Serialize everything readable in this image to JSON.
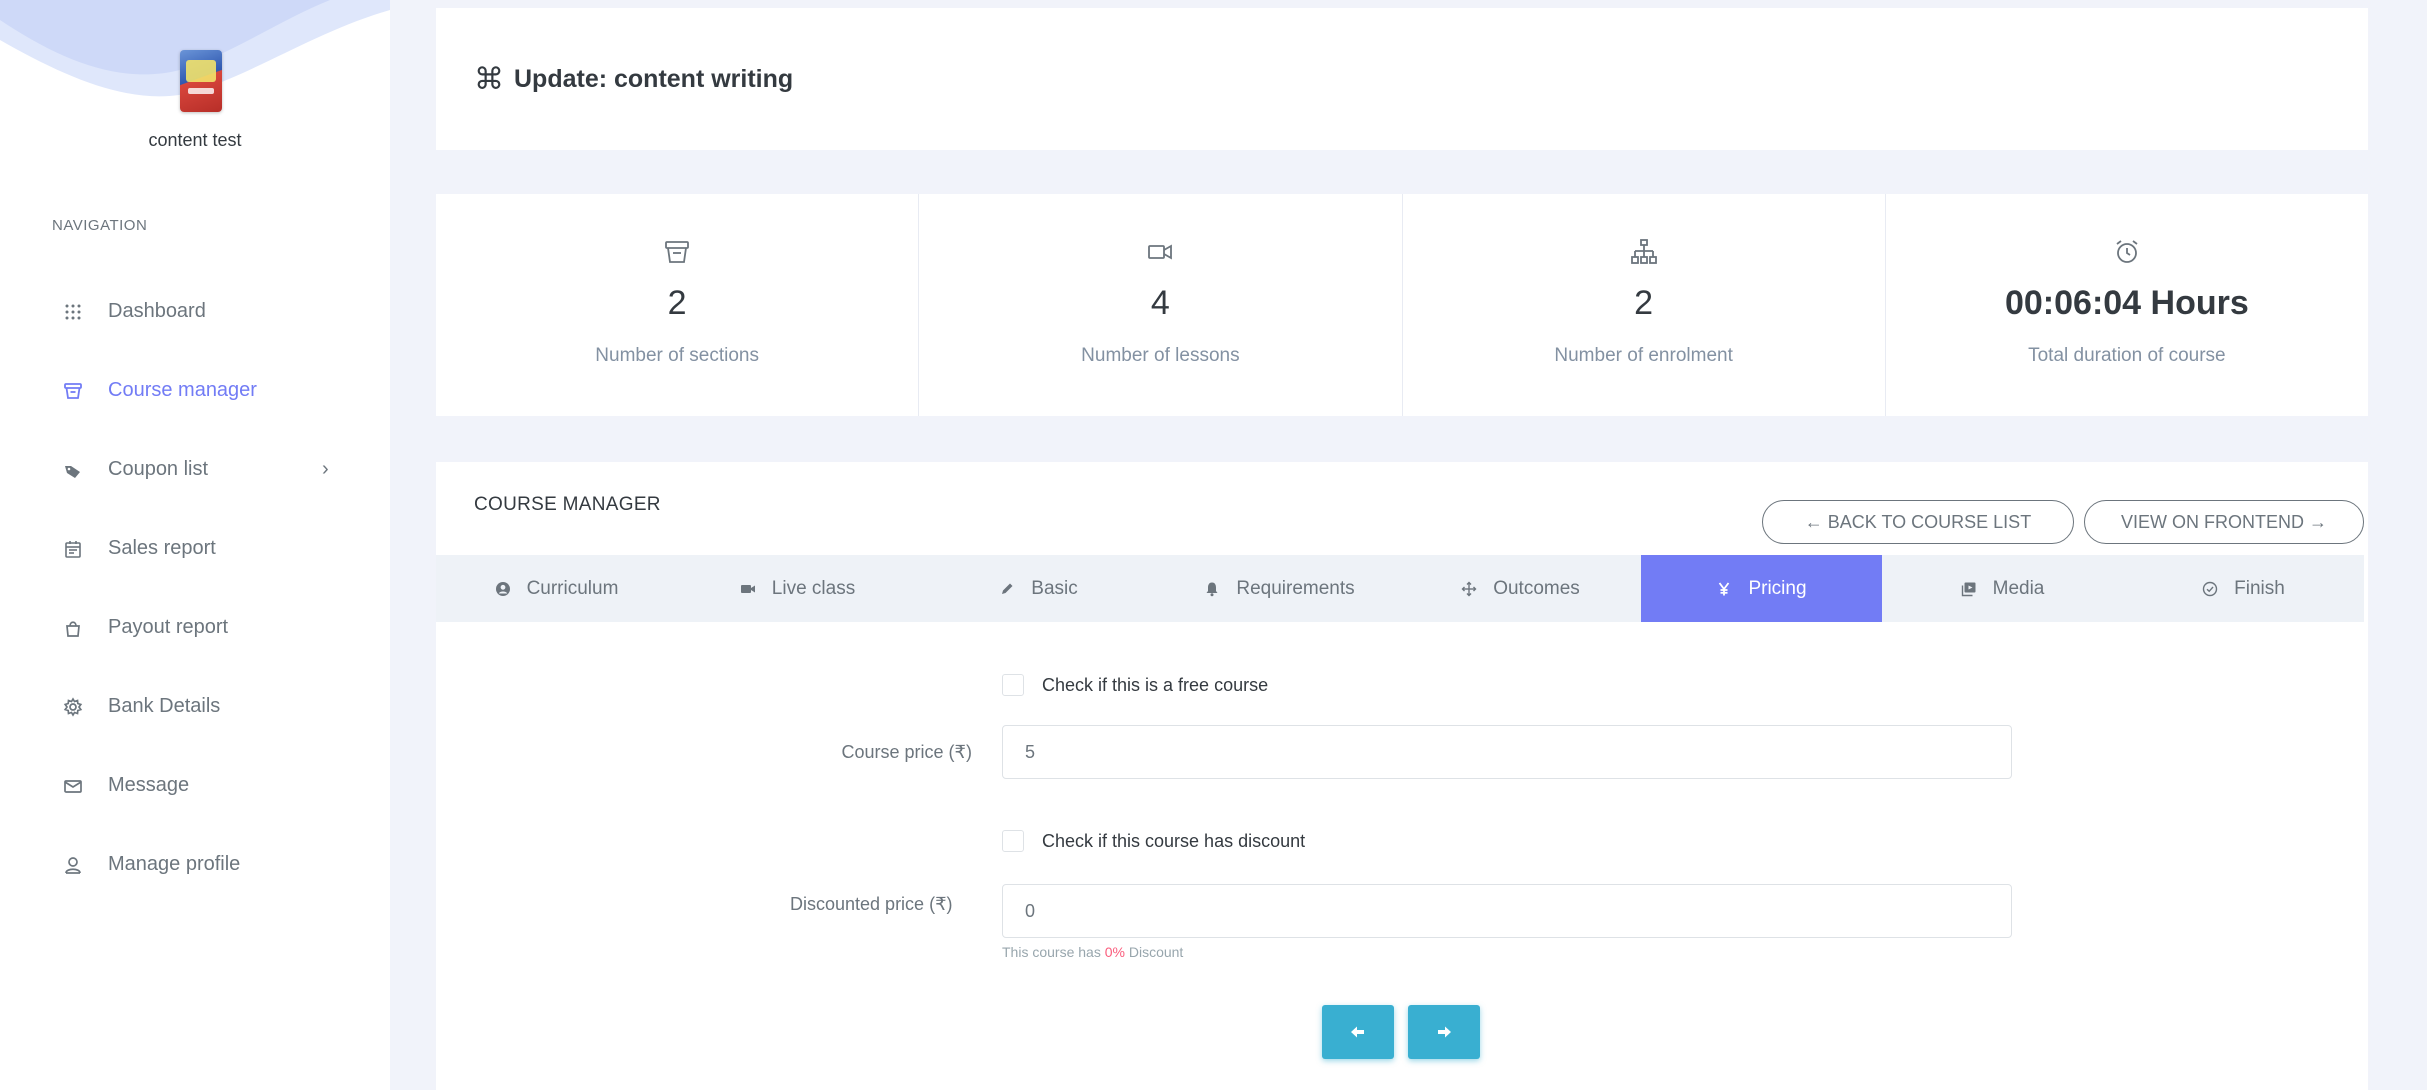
{
  "sidebar": {
    "user_name": "content test",
    "nav_heading": "NAVIGATION",
    "items": [
      {
        "label": "Dashboard",
        "icon": "grid-icon"
      },
      {
        "label": "Course manager",
        "icon": "archive-icon"
      },
      {
        "label": "Coupon list",
        "icon": "tag-icon"
      },
      {
        "label": "Sales report",
        "icon": "calendar-icon"
      },
      {
        "label": "Payout report",
        "icon": "bag-icon"
      },
      {
        "label": "Bank Details",
        "icon": "settings-icon"
      },
      {
        "label": "Message",
        "icon": "mail-icon"
      },
      {
        "label": "Manage profile",
        "icon": "user-icon"
      }
    ],
    "active_color": "#727cf5"
  },
  "header": {
    "title_icon": "⌘",
    "title": "Update: content writing"
  },
  "stats": [
    {
      "icon": "archive-icon",
      "value": "2",
      "label": "Number of sections"
    },
    {
      "icon": "video-icon",
      "value": "4",
      "label": "Number of lessons"
    },
    {
      "icon": "sitemap-icon",
      "value": "2",
      "label": "Number of enrolment"
    },
    {
      "icon": "alarm-clock-icon",
      "value": "00:06:04 Hours",
      "label": "Total duration of course"
    }
  ],
  "manager": {
    "title": "COURSE MANAGER",
    "back_button": "← BACK TO COURSE LIST",
    "frontend_button": "VIEW ON FRONTEND →",
    "tabs": [
      {
        "label": "Curriculum",
        "icon": "account-circle-icon"
      },
      {
        "label": "Live class",
        "icon": "live-video-icon"
      },
      {
        "label": "Basic",
        "icon": "pen-icon"
      },
      {
        "label": "Requirements",
        "icon": "bell-icon"
      },
      {
        "label": "Outcomes",
        "icon": "move-icon"
      },
      {
        "label": "Pricing",
        "icon": "yen-icon"
      },
      {
        "label": "Media",
        "icon": "media-icon"
      },
      {
        "label": "Finish",
        "icon": "check-circle-icon"
      }
    ],
    "active_tab": "Pricing",
    "form": {
      "free_course_label": "Check if this is a free course",
      "free_course_checked": false,
      "price_label": "Course price (₹)",
      "price_value": "5",
      "discount_label": "Check if this course has discount",
      "discount_checked": false,
      "discounted_label": "Discounted price (₹)",
      "discounted_value": "0",
      "help_prefix": "This course has",
      "help_percent": "0%",
      "help_suffix": "Discount"
    },
    "prev_icon": "arrow-left-icon",
    "next_icon": "arrow-right-icon"
  }
}
